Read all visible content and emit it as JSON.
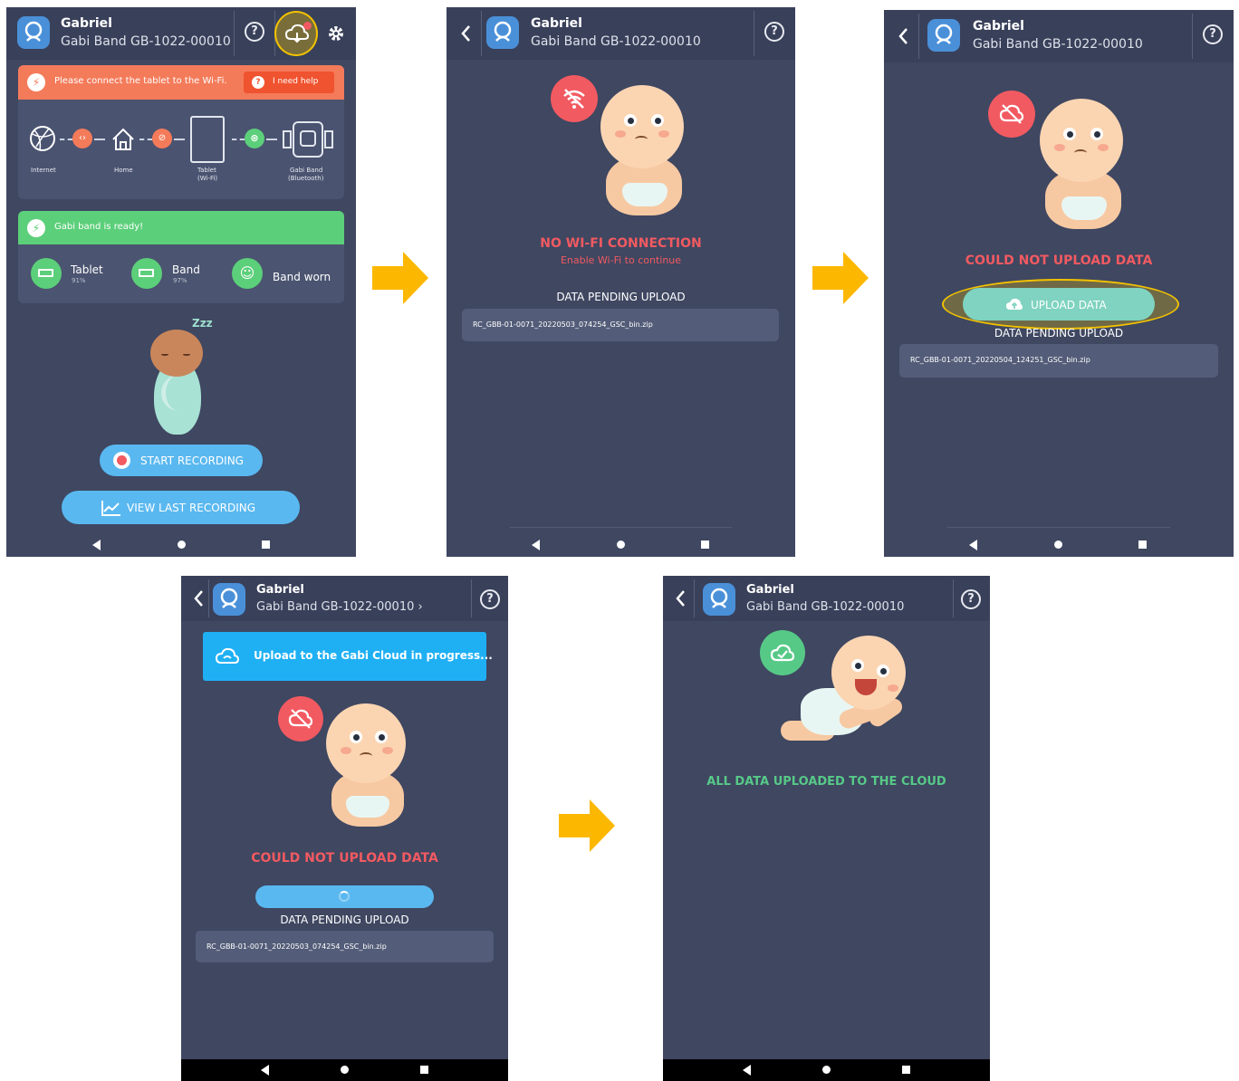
{
  "header": {
    "name": "Gabriel",
    "device": "Gabi Band GB-1022-00010",
    "device_alt": "Gabi Band GB-1022-00010 ›",
    "help": "?"
  },
  "screen1": {
    "wifi_alert": "Please connect the tablet to the Wi-Fi.",
    "need_help": "I need help",
    "diagram": {
      "internet": "Internet",
      "home": "Home",
      "tablet": "Tablet",
      "tablet_sub": "(Wi-Fi)",
      "band": "Gabi Band",
      "band_sub": "(Bluetooth)"
    },
    "ready": "Gabi band is ready!",
    "status": {
      "tablet_label": "Tablet",
      "tablet_pct": "91%",
      "band_label": "Band",
      "band_pct": "97%",
      "worn": "Band worn"
    },
    "zzz": "Zzz",
    "start": "START RECORDING",
    "view_last": "VIEW LAST RECORDING"
  },
  "screen2": {
    "title": "NO WI-FI CONNECTION",
    "subtitle": "Enable Wi-Fi to continue",
    "pending": "DATA PENDING UPLOAD",
    "file": "RC_GBB-01-0071_20220503_074254_GSC_bin.zip"
  },
  "screen3": {
    "title": "COULD NOT UPLOAD DATA",
    "upload": "UPLOAD DATA",
    "pending": "DATA PENDING UPLOAD",
    "file": "RC_GBB-01-0071_20220504_124251_GSC_bin.zip"
  },
  "screen4": {
    "banner": "Upload to the Gabi Cloud in progress...",
    "title": "COULD NOT UPLOAD DATA",
    "pending": "DATA PENDING UPLOAD",
    "file": "RC_GBB-01-0071_20220503_074254_GSC_bin.zip"
  },
  "screen5": {
    "title": "ALL DATA UPLOADED TO THE CLOUD"
  },
  "colors": {
    "background": "#3f4761",
    "header": "#39405a",
    "alert_orange": "#f47b5a",
    "ready_green": "#5ccf7a",
    "error_red": "#f25a61",
    "success_green": "#57c987",
    "button_blue": "#5ab8f0",
    "upload_teal": "#7fd3c0",
    "highlight_yellow": "#f2c200",
    "arrow": "#fcb800"
  },
  "icons": [
    "back-icon",
    "app-logo-icon",
    "help-icon",
    "cloud-notification-icon",
    "settings-gear-icon",
    "bolt-icon",
    "globe-icon",
    "house-icon",
    "tablet-icon",
    "band-icon",
    "bluetooth-icon",
    "wifi-off-icon",
    "battery-icon",
    "baby-face-icon",
    "record-dot-icon",
    "chart-icon",
    "cloud-off-icon",
    "cloud-upload-icon",
    "cloud-check-icon",
    "spinner-icon",
    "flow-arrow-icon"
  ]
}
